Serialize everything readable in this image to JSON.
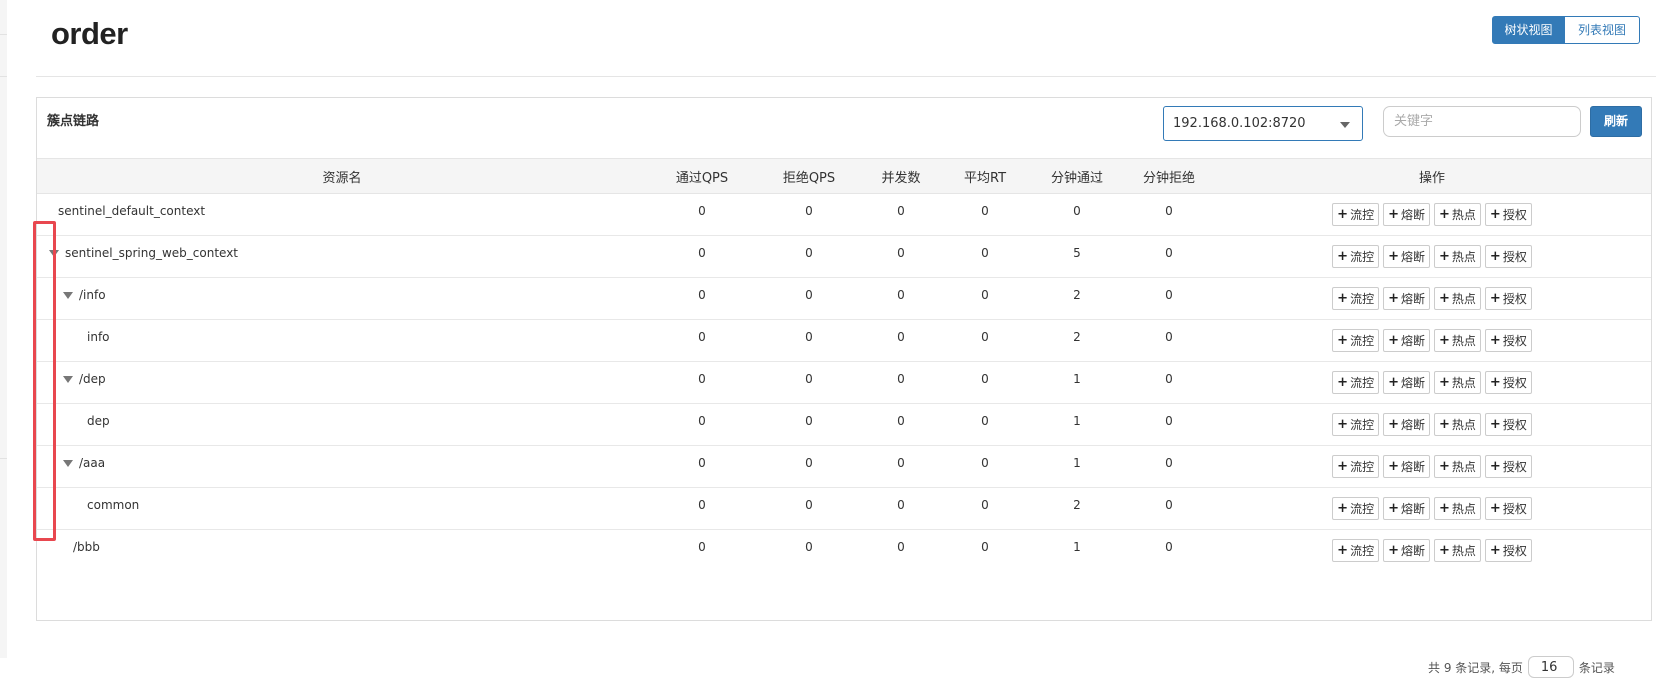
{
  "page": {
    "title": "order"
  },
  "view_toggle": {
    "tree_label": "树状视图",
    "list_label": "列表视图"
  },
  "panel": {
    "title": "簇点链路",
    "machine_select": {
      "value": "192.168.0.102:8720"
    },
    "search": {
      "placeholder": "关键字"
    },
    "refresh_label": "刷新"
  },
  "table": {
    "columns": [
      "资源名",
      "通过QPS",
      "拒绝QPS",
      "并发数",
      "平均RT",
      "分钟通过",
      "分钟拒绝",
      "操作"
    ],
    "op_labels": [
      "流控",
      "熔断",
      "热点",
      "授权"
    ],
    "rows": [
      {
        "name": "sentinel_default_context",
        "level": 0,
        "expandable": false,
        "pass_qps": "0",
        "block_qps": "0",
        "threads": "0",
        "avg_rt": "0",
        "min_pass": "0",
        "min_block": "0"
      },
      {
        "name": "sentinel_spring_web_context",
        "level": 0,
        "expandable": true,
        "pass_qps": "0",
        "block_qps": "0",
        "threads": "0",
        "avg_rt": "0",
        "min_pass": "5",
        "min_block": "0"
      },
      {
        "name": "/info",
        "level": 1,
        "expandable": true,
        "pass_qps": "0",
        "block_qps": "0",
        "threads": "0",
        "avg_rt": "0",
        "min_pass": "2",
        "min_block": "0"
      },
      {
        "name": "info",
        "level": 2,
        "expandable": false,
        "pass_qps": "0",
        "block_qps": "0",
        "threads": "0",
        "avg_rt": "0",
        "min_pass": "2",
        "min_block": "0"
      },
      {
        "name": "/dep",
        "level": 1,
        "expandable": true,
        "pass_qps": "0",
        "block_qps": "0",
        "threads": "0",
        "avg_rt": "0",
        "min_pass": "1",
        "min_block": "0"
      },
      {
        "name": "dep",
        "level": 2,
        "expandable": false,
        "pass_qps": "0",
        "block_qps": "0",
        "threads": "0",
        "avg_rt": "0",
        "min_pass": "1",
        "min_block": "0"
      },
      {
        "name": "/aaa",
        "level": 1,
        "expandable": true,
        "pass_qps": "0",
        "block_qps": "0",
        "threads": "0",
        "avg_rt": "0",
        "min_pass": "1",
        "min_block": "0"
      },
      {
        "name": "common",
        "level": 2,
        "expandable": false,
        "pass_qps": "0",
        "block_qps": "0",
        "threads": "0",
        "avg_rt": "0",
        "min_pass": "2",
        "min_block": "0"
      },
      {
        "name": "/bbb",
        "level": 1,
        "expandable": false,
        "pass_qps": "0",
        "block_qps": "0",
        "threads": "0",
        "avg_rt": "0",
        "min_pass": "1",
        "min_block": "0"
      }
    ]
  },
  "pagination": {
    "prefix": "共 9 条记录, 每页",
    "page_size": "16",
    "suffix": "条记录"
  },
  "colors": {
    "primary": "#337ab7",
    "highlight": "#e8474f"
  }
}
